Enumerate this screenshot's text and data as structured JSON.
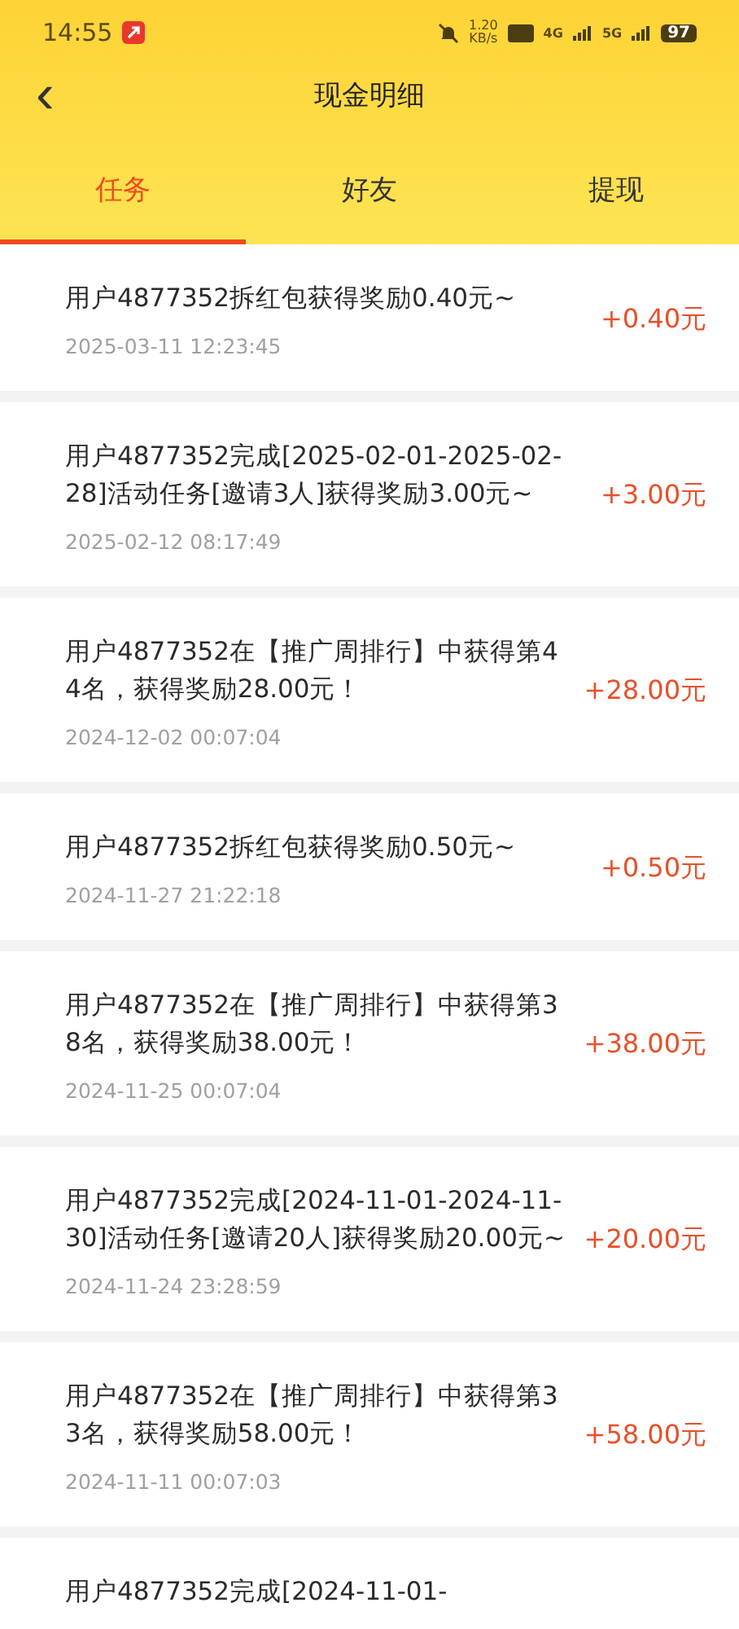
{
  "status_bar": {
    "time": "14:55",
    "speed": "1.20",
    "speed_unit": "KB/s",
    "signal_1": "4G",
    "signal_2": "5G",
    "battery": "97"
  },
  "header": {
    "back": "‹",
    "title": "现金明细"
  },
  "tabs": [
    {
      "label": "任务",
      "selected": true
    },
    {
      "label": "好友",
      "selected": false
    },
    {
      "label": "提现",
      "selected": false
    }
  ],
  "records": [
    {
      "text": "用户4877352拆红包获得奖励0.40元~",
      "time": "2025-03-11 12:23:45",
      "amount": "+0.40元"
    },
    {
      "text": "用户4877352完成[2025-02-01-2025-02-28]活动任务[邀请3人]获得奖励3.00元~",
      "time": "2025-02-12 08:17:49",
      "amount": "+3.00元"
    },
    {
      "text": "用户4877352在【推广周排行】中获得第44名，获得奖励28.00元！",
      "time": "2024-12-02 00:07:04",
      "amount": "+28.00元"
    },
    {
      "text": "用户4877352拆红包获得奖励0.50元~",
      "time": "2024-11-27 21:22:18",
      "amount": "+0.50元"
    },
    {
      "text": "用户4877352在【推广周排行】中获得第38名，获得奖励38.00元！",
      "time": "2024-11-25 00:07:04",
      "amount": "+38.00元"
    },
    {
      "text": "用户4877352完成[2024-11-01-2024-11-30]活动任务[邀请20人]获得奖励20.00元~",
      "time": "2024-11-24 23:28:59",
      "amount": "+20.00元"
    },
    {
      "text": "用户4877352在【推广周排行】中获得第33名，获得奖励58.00元！",
      "time": "2024-11-11 00:07:03",
      "amount": "+58.00元"
    },
    {
      "text": "用户4877352完成[2024-11-01-"
    }
  ]
}
